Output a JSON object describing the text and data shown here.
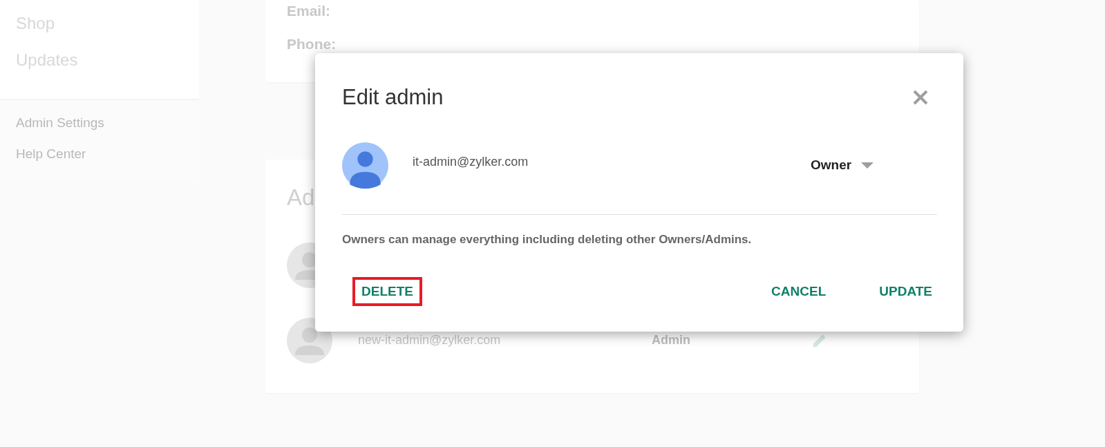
{
  "sidebar": {
    "items": [
      {
        "label": "Shop"
      },
      {
        "label": "Updates"
      }
    ],
    "footer_items": [
      {
        "label": "Admin Settings"
      },
      {
        "label": "Help Center"
      }
    ]
  },
  "profile_card": {
    "fields": [
      "Email:",
      "Phone:"
    ]
  },
  "admins_card": {
    "title": "Ad",
    "rows": [
      {
        "email": "",
        "role": ""
      },
      {
        "email": "new-it-admin@zylker.com",
        "role": "Admin"
      }
    ]
  },
  "dialog": {
    "title": "Edit admin",
    "email": "it-admin@zylker.com",
    "role": "Owner",
    "description": "Owners can manage everything including deleting other Owners/Admins.",
    "buttons": [
      {
        "label": "DELETE",
        "kind": "left",
        "highlighted": true
      },
      {
        "label": "CANCEL",
        "kind": "right",
        "highlighted": false
      },
      {
        "label": "UPDATE",
        "kind": "right",
        "highlighted": false
      }
    ]
  }
}
